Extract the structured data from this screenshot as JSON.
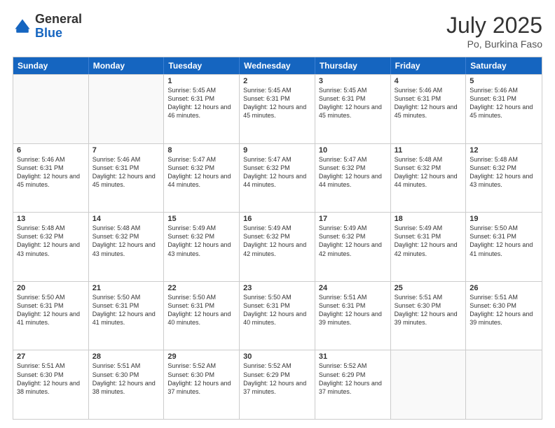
{
  "header": {
    "logo_general": "General",
    "logo_blue": "Blue",
    "month_title": "July 2025",
    "location": "Po, Burkina Faso"
  },
  "days_of_week": [
    "Sunday",
    "Monday",
    "Tuesday",
    "Wednesday",
    "Thursday",
    "Friday",
    "Saturday"
  ],
  "weeks": [
    [
      {
        "day": "",
        "empty": true
      },
      {
        "day": "",
        "empty": true
      },
      {
        "day": "1",
        "sunrise": "5:45 AM",
        "sunset": "6:31 PM",
        "daylight": "12 hours and 46 minutes."
      },
      {
        "day": "2",
        "sunrise": "5:45 AM",
        "sunset": "6:31 PM",
        "daylight": "12 hours and 45 minutes."
      },
      {
        "day": "3",
        "sunrise": "5:45 AM",
        "sunset": "6:31 PM",
        "daylight": "12 hours and 45 minutes."
      },
      {
        "day": "4",
        "sunrise": "5:46 AM",
        "sunset": "6:31 PM",
        "daylight": "12 hours and 45 minutes."
      },
      {
        "day": "5",
        "sunrise": "5:46 AM",
        "sunset": "6:31 PM",
        "daylight": "12 hours and 45 minutes."
      }
    ],
    [
      {
        "day": "6",
        "sunrise": "5:46 AM",
        "sunset": "6:31 PM",
        "daylight": "12 hours and 45 minutes."
      },
      {
        "day": "7",
        "sunrise": "5:46 AM",
        "sunset": "6:31 PM",
        "daylight": "12 hours and 45 minutes."
      },
      {
        "day": "8",
        "sunrise": "5:47 AM",
        "sunset": "6:32 PM",
        "daylight": "12 hours and 44 minutes."
      },
      {
        "day": "9",
        "sunrise": "5:47 AM",
        "sunset": "6:32 PM",
        "daylight": "12 hours and 44 minutes."
      },
      {
        "day": "10",
        "sunrise": "5:47 AM",
        "sunset": "6:32 PM",
        "daylight": "12 hours and 44 minutes."
      },
      {
        "day": "11",
        "sunrise": "5:48 AM",
        "sunset": "6:32 PM",
        "daylight": "12 hours and 44 minutes."
      },
      {
        "day": "12",
        "sunrise": "5:48 AM",
        "sunset": "6:32 PM",
        "daylight": "12 hours and 43 minutes."
      }
    ],
    [
      {
        "day": "13",
        "sunrise": "5:48 AM",
        "sunset": "6:32 PM",
        "daylight": "12 hours and 43 minutes."
      },
      {
        "day": "14",
        "sunrise": "5:48 AM",
        "sunset": "6:32 PM",
        "daylight": "12 hours and 43 minutes."
      },
      {
        "day": "15",
        "sunrise": "5:49 AM",
        "sunset": "6:32 PM",
        "daylight": "12 hours and 43 minutes."
      },
      {
        "day": "16",
        "sunrise": "5:49 AM",
        "sunset": "6:32 PM",
        "daylight": "12 hours and 42 minutes."
      },
      {
        "day": "17",
        "sunrise": "5:49 AM",
        "sunset": "6:32 PM",
        "daylight": "12 hours and 42 minutes."
      },
      {
        "day": "18",
        "sunrise": "5:49 AM",
        "sunset": "6:31 PM",
        "daylight": "12 hours and 42 minutes."
      },
      {
        "day": "19",
        "sunrise": "5:50 AM",
        "sunset": "6:31 PM",
        "daylight": "12 hours and 41 minutes."
      }
    ],
    [
      {
        "day": "20",
        "sunrise": "5:50 AM",
        "sunset": "6:31 PM",
        "daylight": "12 hours and 41 minutes."
      },
      {
        "day": "21",
        "sunrise": "5:50 AM",
        "sunset": "6:31 PM",
        "daylight": "12 hours and 41 minutes."
      },
      {
        "day": "22",
        "sunrise": "5:50 AM",
        "sunset": "6:31 PM",
        "daylight": "12 hours and 40 minutes."
      },
      {
        "day": "23",
        "sunrise": "5:50 AM",
        "sunset": "6:31 PM",
        "daylight": "12 hours and 40 minutes."
      },
      {
        "day": "24",
        "sunrise": "5:51 AM",
        "sunset": "6:31 PM",
        "daylight": "12 hours and 39 minutes."
      },
      {
        "day": "25",
        "sunrise": "5:51 AM",
        "sunset": "6:30 PM",
        "daylight": "12 hours and 39 minutes."
      },
      {
        "day": "26",
        "sunrise": "5:51 AM",
        "sunset": "6:30 PM",
        "daylight": "12 hours and 39 minutes."
      }
    ],
    [
      {
        "day": "27",
        "sunrise": "5:51 AM",
        "sunset": "6:30 PM",
        "daylight": "12 hours and 38 minutes."
      },
      {
        "day": "28",
        "sunrise": "5:51 AM",
        "sunset": "6:30 PM",
        "daylight": "12 hours and 38 minutes."
      },
      {
        "day": "29",
        "sunrise": "5:52 AM",
        "sunset": "6:30 PM",
        "daylight": "12 hours and 37 minutes."
      },
      {
        "day": "30",
        "sunrise": "5:52 AM",
        "sunset": "6:29 PM",
        "daylight": "12 hours and 37 minutes."
      },
      {
        "day": "31",
        "sunrise": "5:52 AM",
        "sunset": "6:29 PM",
        "daylight": "12 hours and 37 minutes."
      },
      {
        "day": "",
        "empty": true
      },
      {
        "day": "",
        "empty": true
      }
    ]
  ]
}
